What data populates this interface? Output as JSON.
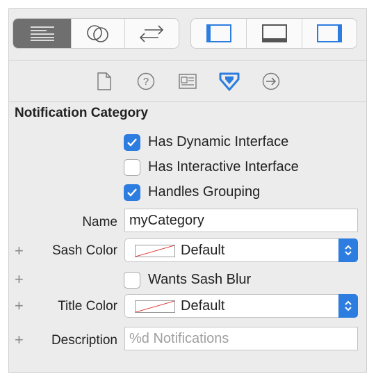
{
  "colors": {
    "accent": "#2d7de0",
    "active_segment": "#6f6f6f"
  },
  "toolbar": {
    "left_group": [
      {
        "icon": "text-lines-icon",
        "active": true
      },
      {
        "icon": "overlapping-circles-icon",
        "active": false
      },
      {
        "icon": "swap-arrows-icon",
        "active": false
      }
    ],
    "right_group": [
      {
        "icon": "left-panel-icon"
      },
      {
        "icon": "bottom-panel-icon"
      },
      {
        "icon": "right-panel-icon"
      }
    ]
  },
  "inspector_tabs": [
    {
      "icon": "file-icon",
      "selected": false
    },
    {
      "icon": "help-icon",
      "selected": false
    },
    {
      "icon": "identity-card-icon",
      "selected": false
    },
    {
      "icon": "attributes-arrow-icon",
      "selected": true
    },
    {
      "icon": "connections-arrow-icon",
      "selected": false
    }
  ],
  "section": {
    "title": "Notification Category"
  },
  "checkboxes": {
    "dynamic_interface": {
      "label": "Has Dynamic Interface",
      "checked": true
    },
    "interactive_interface": {
      "label": "Has Interactive Interface",
      "checked": false
    },
    "handles_grouping": {
      "label": "Handles Grouping",
      "checked": true
    },
    "wants_sash_blur": {
      "label": "Wants Sash Blur",
      "checked": false
    }
  },
  "fields": {
    "name": {
      "label": "Name",
      "value": "myCategory"
    },
    "sash_color": {
      "label": "Sash Color",
      "value": "Default"
    },
    "title_color": {
      "label": "Title Color",
      "value": "Default"
    },
    "description": {
      "label": "Description",
      "placeholder": "%d Notifications",
      "value": ""
    }
  },
  "plus_symbol": "+"
}
